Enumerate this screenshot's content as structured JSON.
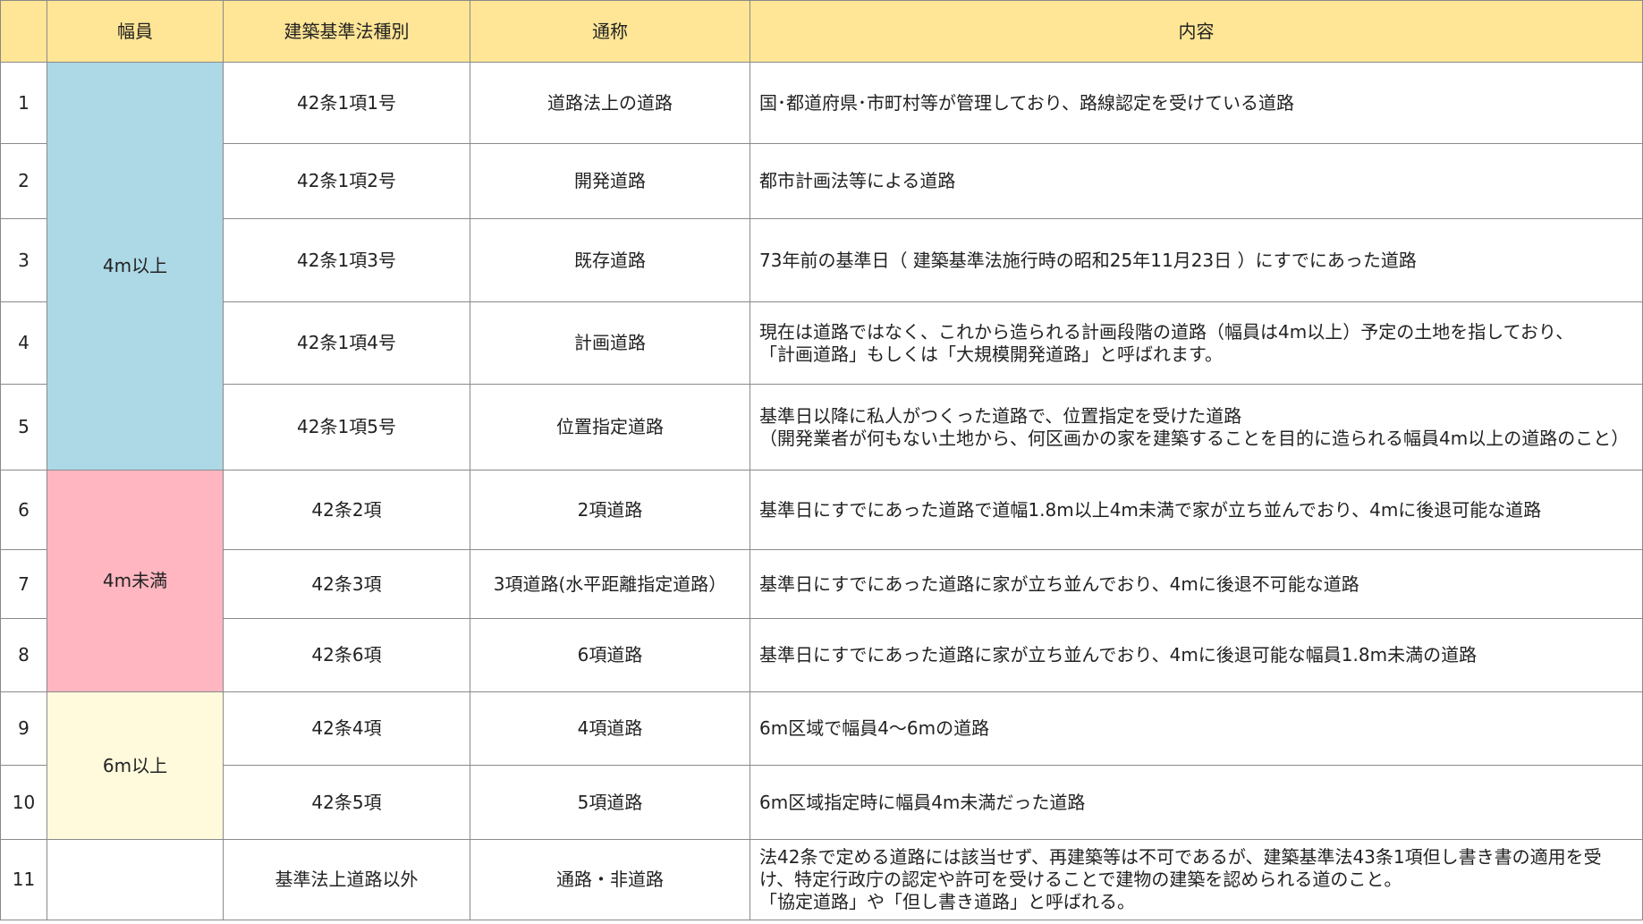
{
  "headers": {
    "num": "",
    "width": "幅員",
    "law": "建築基準法種別",
    "name": "通称",
    "content": "内容"
  },
  "groups": {
    "g1": "4m以上",
    "g2": "4m未満",
    "g3": "6m以上",
    "g4": ""
  },
  "rows": [
    {
      "num": "1",
      "law": "42条1項1号",
      "name": "道路法上の道路",
      "content": [
        "国･都道府県･市町村等が管理しており、路線認定を受けている道路"
      ]
    },
    {
      "num": "2",
      "law": "42条1項2号",
      "name": "開発道路",
      "content": [
        "都市計画法等による道路"
      ]
    },
    {
      "num": "3",
      "law": "42条1項3号",
      "name": "既存道路",
      "content": [
        "73年前の基準日（ 建築基準法施行時の昭和25年11月23日 ）にすでにあった道路"
      ]
    },
    {
      "num": "4",
      "law": "42条1項4号",
      "name": "計画道路",
      "content": [
        "現在は道路ではなく、これから造られる計画段階の道路（幅員は4m以上）予定の土地を指しており、",
        "「計画道路」もしくは「大規模開発道路」と呼ばれます。"
      ]
    },
    {
      "num": "5",
      "law": "42条1項5号",
      "name": "位置指定道路",
      "content": [
        "基準日以降に私人がつくった道路で、位置指定を受けた道路",
        "（開発業者が何もない土地から、何区画かの家を建築することを目的に造られる幅員4m以上の道路のこと）"
      ]
    },
    {
      "num": "6",
      "law": "42条2項",
      "name": "2項道路",
      "content": [
        "基準日にすでにあった道路で道幅1.8m以上4m未満で家が立ち並んでおり、4mに後退可能な道路"
      ]
    },
    {
      "num": "7",
      "law": "42条3項",
      "name": "3項道路(水平距離指定道路）",
      "content": [
        "基準日にすでにあった道路に家が立ち並んでおり、4mに後退不可能な道路"
      ]
    },
    {
      "num": "8",
      "law": "42条6項",
      "name": "6項道路",
      "content": [
        "基準日にすでにあった道路に家が立ち並んでおり、4mに後退可能な幅員1.8m未満の道路"
      ]
    },
    {
      "num": "9",
      "law": "42条4項",
      "name": "4項道路",
      "content": [
        "6m区域で幅員4～6mの道路"
      ]
    },
    {
      "num": "10",
      "law": "42条5項",
      "name": "5項道路",
      "content": [
        "6m区域指定時に幅員4m未満だった道路"
      ]
    },
    {
      "num": "11",
      "law": "基準法上道路以外",
      "name": "通路・非道路",
      "content": [
        "法42条で定める道路には該当せず、再建築等は不可であるが、建築基準法43条1項但し書き書の適用を受",
        "け、特定行政庁の認定や許可を受けることで建物の建築を認められる道のこと。",
        "「協定道路」や「但し書き道路」と呼ばれる。"
      ]
    }
  ],
  "colors": {
    "header": "#ffe596",
    "group_4m_or_more": "#add8e6",
    "group_under_4m": "#ffb6c1",
    "group_6m_or_more": "#fffadc",
    "border": "#8a8a8a"
  }
}
